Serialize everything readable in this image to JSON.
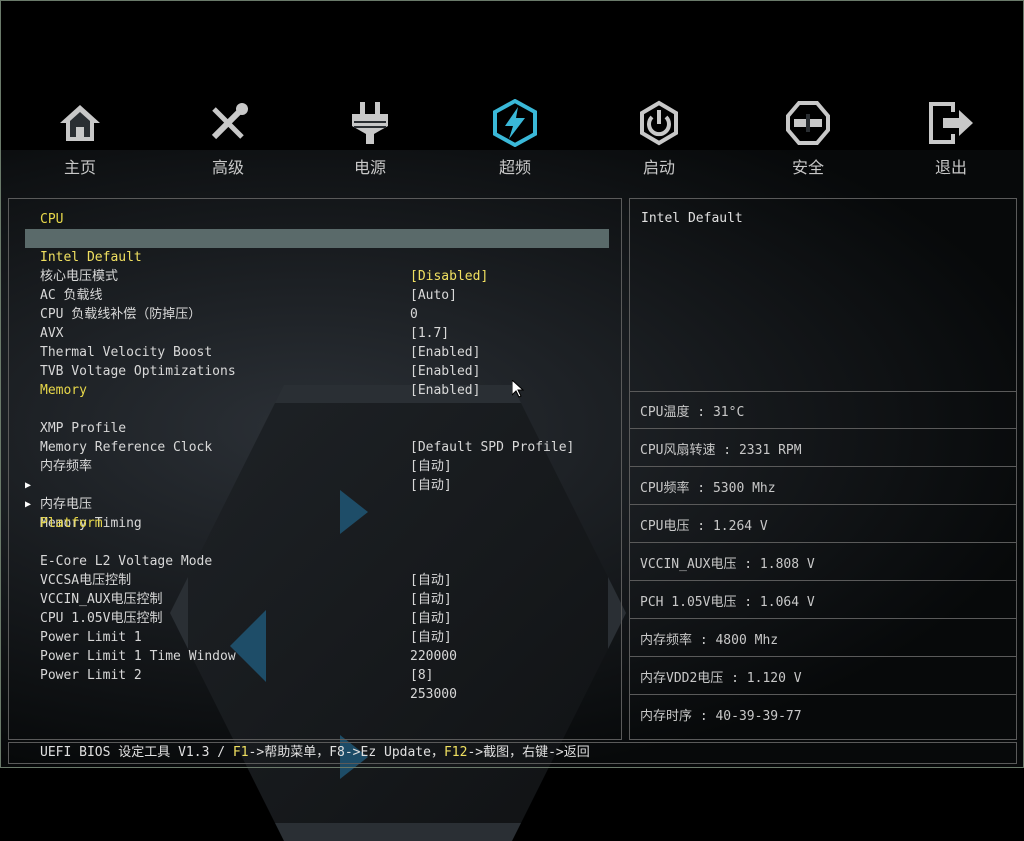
{
  "nav": [
    {
      "label": "主页",
      "icon": "home-icon"
    },
    {
      "label": "高级",
      "icon": "tools-icon"
    },
    {
      "label": "电源",
      "icon": "power-plug-icon"
    },
    {
      "label": "超频",
      "icon": "overclock-bolt-icon"
    },
    {
      "label": "启动",
      "icon": "power-button-icon"
    },
    {
      "label": "安全",
      "icon": "shield-icon"
    },
    {
      "label": "退出",
      "icon": "exit-icon"
    }
  ],
  "sections": {
    "cpu": "CPU",
    "memory": "Memory",
    "platform": "Platform"
  },
  "rows": [
    {
      "label": "Intel Default",
      "value": "[Disabled]"
    },
    {
      "label": "核心电压模式",
      "value": "[Auto]"
    },
    {
      "label": "AC 负载线",
      "value": "0"
    },
    {
      "label": "CPU 负载线补偿（防掉压）",
      "value": "[1.7]"
    },
    {
      "label": "AVX",
      "value": "[Enabled]"
    },
    {
      "label": "Thermal Velocity Boost",
      "value": "[Enabled]"
    },
    {
      "label": "TVB Voltage Optimizations",
      "value": "[Enabled]"
    },
    {
      "label": "XMP Profile",
      "value": "[Default SPD Profile]"
    },
    {
      "label": "Memory Reference Clock",
      "value": "[自动]"
    },
    {
      "label": "内存频率",
      "value": "[自动]"
    },
    {
      "label": "内存电压",
      "value": ""
    },
    {
      "label": "Memory Timing",
      "value": ""
    },
    {
      "label": "E-Core L2 Voltage Mode",
      "value": "[自动]"
    },
    {
      "label": "VCCSA电压控制",
      "value": "[自动]"
    },
    {
      "label": "VCCIN_AUX电压控制",
      "value": "[自动]"
    },
    {
      "label": "CPU 1.05V电压控制",
      "value": "[自动]"
    },
    {
      "label": "Power Limit 1",
      "value": "220000"
    },
    {
      "label": "Power Limit 1 Time Window",
      "value": "[8]"
    },
    {
      "label": "Power Limit 2",
      "value": "253000"
    }
  ],
  "help": "Intel Default",
  "stats": [
    "CPU温度 : 31°C",
    "CPU风扇转速 : 2331 RPM",
    "CPU频率 : 5300 Mhz",
    "CPU电压 : 1.264 V",
    "VCCIN_AUX电压 : 1.808 V",
    "PCH 1.05V电压 : 1.064 V",
    "内存频率 : 4800 Mhz",
    "内存VDD2电压 : 1.120 V",
    "内存时序 : 40-39-39-77"
  ],
  "footer": {
    "prefix": "UEFI BIOS 设定工具 V1.3 / ",
    "f1": "F1",
    "f1_text": "->帮助菜单，F8->Ez Update，",
    "f12": "F12",
    "f12_text": "->截图，右键->返回"
  },
  "colors": {
    "accent": "#f0e060",
    "highlight": "#5a6a6a",
    "active_icon": "#3ab8d8"
  }
}
